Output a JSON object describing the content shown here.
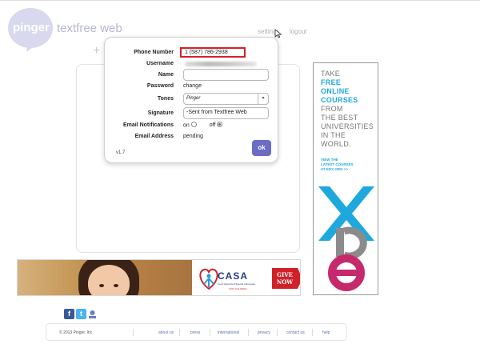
{
  "brand": {
    "logo_text": "pinger",
    "app_name": "textfree web"
  },
  "top_nav": {
    "links": [
      "settings",
      "logout"
    ]
  },
  "settings": {
    "phone_label": "Phone Number",
    "phone_value": "1 (587) 786-2938",
    "username_label": "Username",
    "name_label": "Name",
    "name_value": "",
    "password_label": "Password",
    "password_link": "change",
    "tones_label": "Tones",
    "tones_value": "Pinger",
    "signature_label": "Signature",
    "signature_value": "-Sent from Textfree Web",
    "notifications_label": "Email Notifications",
    "notifications_on": "on",
    "notifications_off": "off",
    "notifications_selected": "off",
    "email_label": "Email Address",
    "email_status": "pending",
    "version": "v1.7",
    "ok_label": "ok"
  },
  "right_ad": {
    "line1": "TAKE",
    "line2": "FREE",
    "line3": "ONLINE",
    "line4": "COURSES",
    "line5": "FROM",
    "line6": "THE BEST",
    "line7": "UNIVERSITIES",
    "line8": "IN THE",
    "line9": "WORLD.",
    "cta1": "VIEW THE",
    "cta2": "LATEST COURSES",
    "cta3": "AT EDX.ORG >>",
    "logo_text": "edX",
    "colors": {
      "blue": "#1ea8dd",
      "magenta": "#c62a6c",
      "gray": "#8b8b8b"
    }
  },
  "bottom_ad": {
    "org": "CASA",
    "tagline": "Court Appointed Special Advocates",
    "tagline2": "FOR CHILDREN",
    "button_line1": "GIVE",
    "button_line2": "NOW"
  },
  "social": {
    "facebook": "f",
    "twitter": "t"
  },
  "footer": {
    "copyright": "© 2013 Pinger, Inc.",
    "links": [
      "about us",
      "press",
      "international",
      "privacy",
      "contact us",
      "help"
    ]
  },
  "colors": {
    "accent": "#6a6dc4",
    "link": "#5b71b3",
    "highlight": "#d6202a",
    "logo": "#d8d8ee"
  }
}
